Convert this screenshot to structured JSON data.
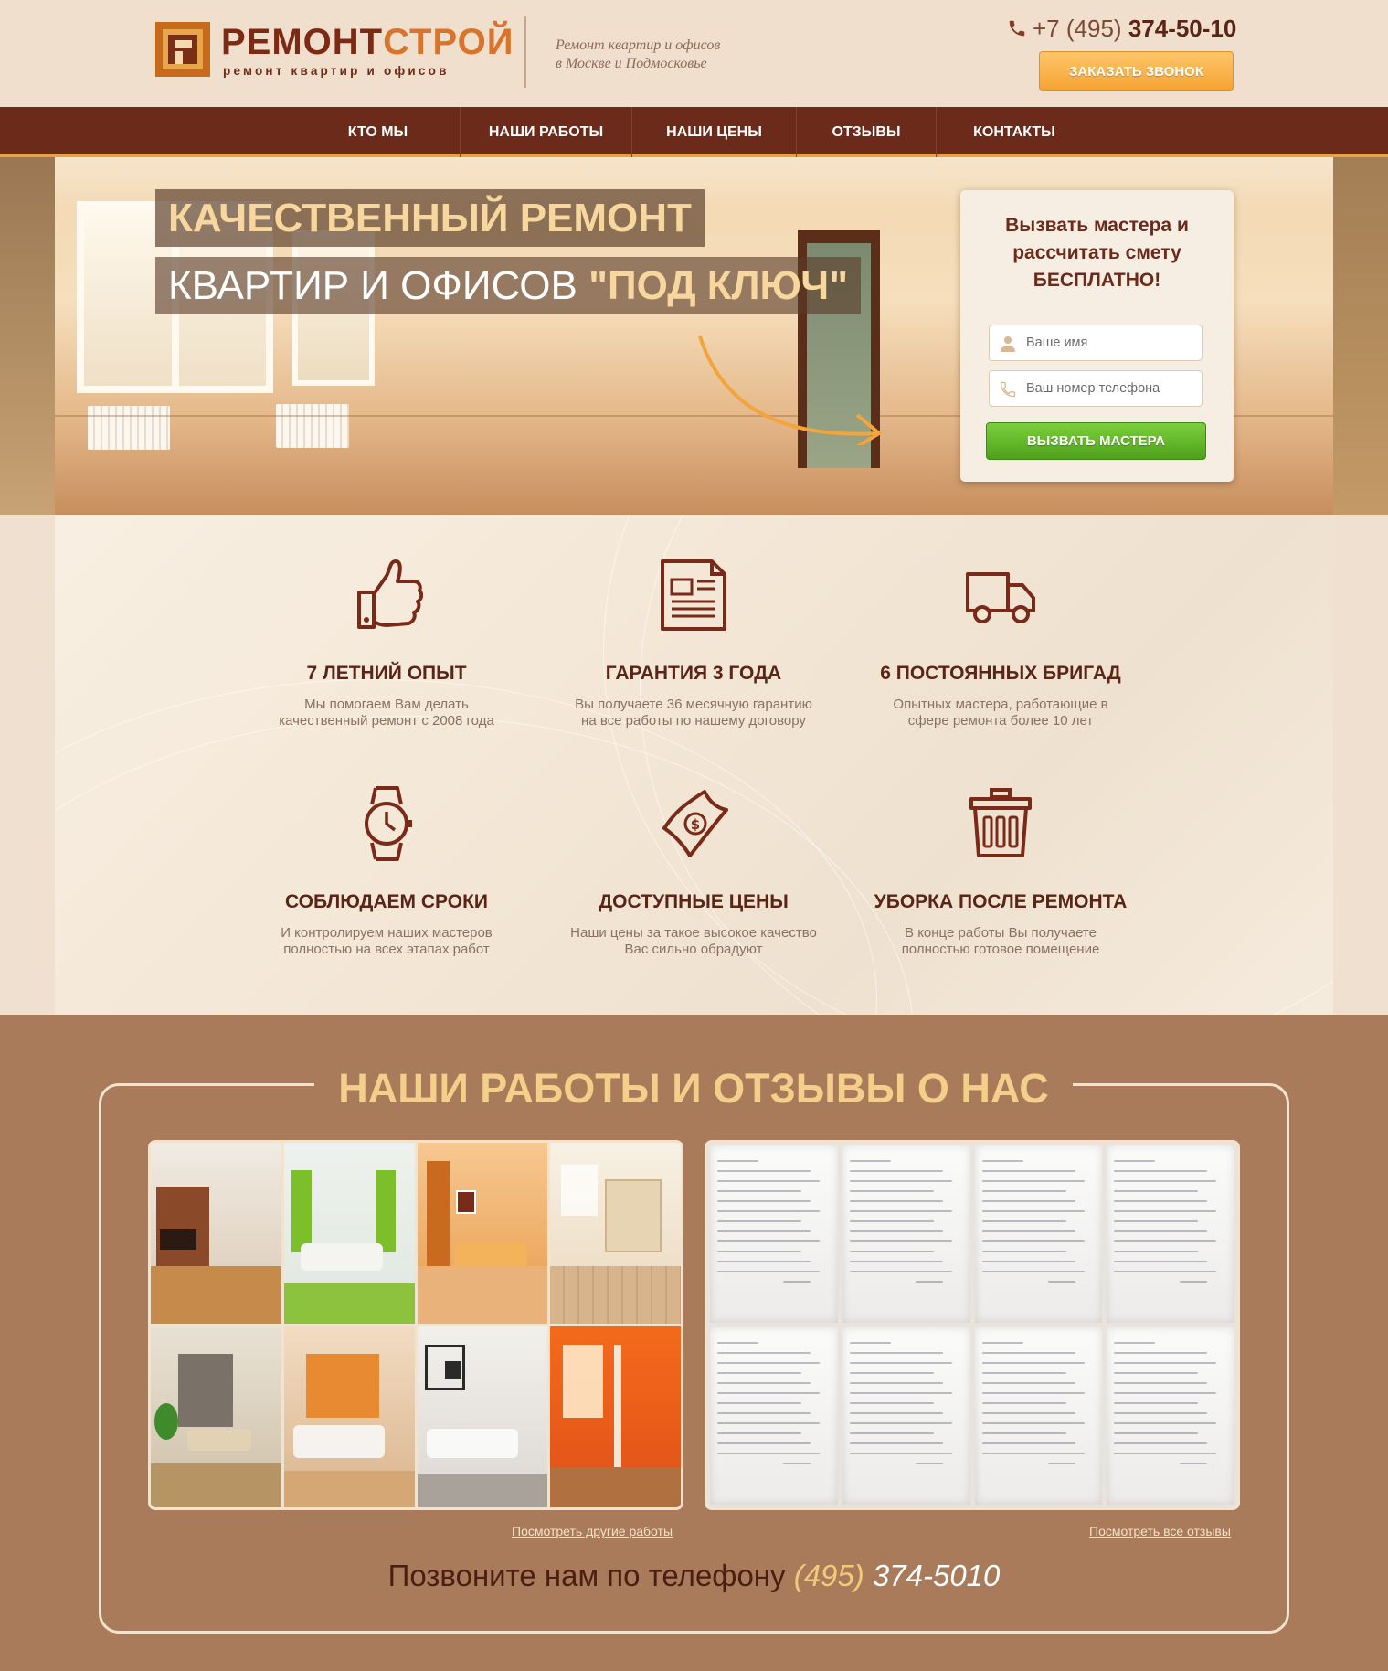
{
  "header": {
    "logo_name_a": "РЕМОНТ",
    "logo_name_b": "СТРОЙ",
    "logo_sub": "ремонт квартир и офисов",
    "tagline_line1": "Ремонт квартир и офисов",
    "tagline_line2": "в Москве и Подмосковье",
    "phone_prefix": "+7 (495)",
    "phone_number": "374-50-10",
    "callback_label": "ЗАКАЗАТЬ ЗВОНОК"
  },
  "nav": {
    "items": [
      {
        "label": "КТО МЫ"
      },
      {
        "label": "НАШИ РАБОТЫ"
      },
      {
        "label": "НАШИ ЦЕНЫ"
      },
      {
        "label": "ОТЗЫВЫ"
      },
      {
        "label": "КОНТАКТЫ"
      }
    ]
  },
  "hero": {
    "title_line1": "КАЧЕСТВЕННЫЙ РЕМОНТ",
    "title_line2_a": "КВАРТИР И ОФИСОВ",
    "title_line2_b": "\"ПОД КЛЮЧ\""
  },
  "form": {
    "title_line1": "Вызвать мастера и",
    "title_line2": "рассчитать смету",
    "title_line3": "БЕСПЛАТНО!",
    "name_placeholder": "Ваше имя",
    "phone_placeholder": "Ваш номер телефона",
    "submit_label": "ВЫЗВАТЬ МАСТЕРА"
  },
  "features": [
    {
      "icon": "thumbs-up-icon",
      "title": "7 ЛЕТНИЙ ОПЫТ",
      "desc1": "Мы помогаем Вам делать",
      "desc2": "качественный ремонт с 2008 года"
    },
    {
      "icon": "document-icon",
      "title": "ГАРАНТИЯ 3 ГОДА",
      "desc1": "Вы получаете 36 месячную гарантию",
      "desc2": "на все работы по нашему договору"
    },
    {
      "icon": "truck-icon",
      "title": "6 ПОСТОЯННЫХ БРИГАД",
      "desc1": "Опытных мастера, работающие в",
      "desc2": "сфере ремонта более 10 лет"
    },
    {
      "icon": "watch-icon",
      "title": "СОБЛЮДАЕМ СРОКИ",
      "desc1": "И контролируем наших мастеров",
      "desc2": "полностью на всех этапах работ"
    },
    {
      "icon": "money-icon",
      "title": "ДОСТУПНЫЕ ЦЕНЫ",
      "desc1": "Наши цены за такое высокое качество",
      "desc2": "Вас сильно обрадуют"
    },
    {
      "icon": "trash-bin-icon",
      "title": "УБОРКА ПОСЛЕ РЕМОНТА",
      "desc1": "В конце работы Вы получаете",
      "desc2": "полностью готовое помещение"
    }
  ],
  "works": {
    "title": "НАШИ РАБОТЫ И ОТЗЫВЫ О НАС",
    "gallery_link": "Посмотреть другие работы",
    "reviews_link": "Посмотреть все отзывы",
    "cta_text": "Позвоните нам по телефону",
    "cta_code": "(495)",
    "cta_number": "374-5010"
  },
  "colors": {
    "brand_dark": "#6b2a1a",
    "accent_orange": "#f5a332",
    "accent_green": "#5bb022",
    "section_brown": "#a97b5b"
  }
}
